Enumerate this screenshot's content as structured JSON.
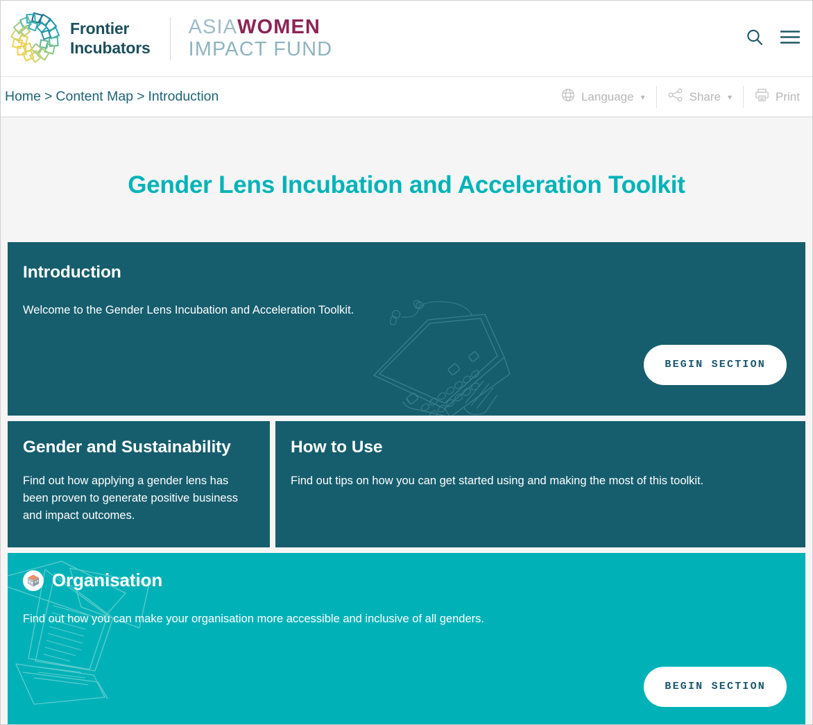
{
  "header": {
    "brand_frontier_line1": "Frontier",
    "brand_frontier_line2": "Incubators",
    "brand_awif_asia": "ASIA",
    "brand_awif_women": "WOMEN",
    "brand_awif_line2": "IMPACT FUND",
    "search_icon": "search-icon",
    "menu_icon": "hamburger-menu-icon"
  },
  "breadcrumb": {
    "items": [
      "Home",
      "Content Map",
      "Introduction"
    ],
    "separator": ">"
  },
  "utilities": [
    {
      "label": "Language",
      "icon": "globe-icon",
      "has_chevron": true
    },
    {
      "label": "Share",
      "icon": "share-nodes-icon",
      "has_chevron": true
    },
    {
      "label": "Print",
      "icon": "printer-icon",
      "has_chevron": false
    }
  ],
  "main": {
    "page_title": "Gender Lens Incubation and Acceleration Toolkit",
    "cards": {
      "intro": {
        "title": "Introduction",
        "body": "Welcome to the Gender Lens Incubation and Acceleration Toolkit.",
        "button_label": "BEGIN SECTION",
        "illustration": "laptop-with-earbuds-line-art"
      },
      "gender_sustainability": {
        "title": "Gender and Sustainability",
        "body": "Find out how applying a gender lens has been proven to generate positive business and impact outcomes."
      },
      "how_to_use": {
        "title": "How to Use",
        "body": "Find out tips on how you can get started using and making the most of this toolkit."
      },
      "organisation": {
        "title": "Organisation",
        "body": "Find out how you can make your organisation more accessible and inclusive of all genders.",
        "button_label": "BEGIN SECTION",
        "badge_icon": "building-block-icon",
        "illustration": "scattered-papers-line-art"
      }
    }
  },
  "colors": {
    "accent_cyan": "#00b3b8",
    "card_dark_teal": "#165e6e",
    "card_bright_teal": "#00b2b8",
    "brand_dark_teal": "#1d4f5c",
    "brand_magenta": "#8a2457",
    "breadcrumb_text": "#1d6276",
    "utility_gray": "#b6b6b6",
    "page_background": "#f5f5f5"
  }
}
